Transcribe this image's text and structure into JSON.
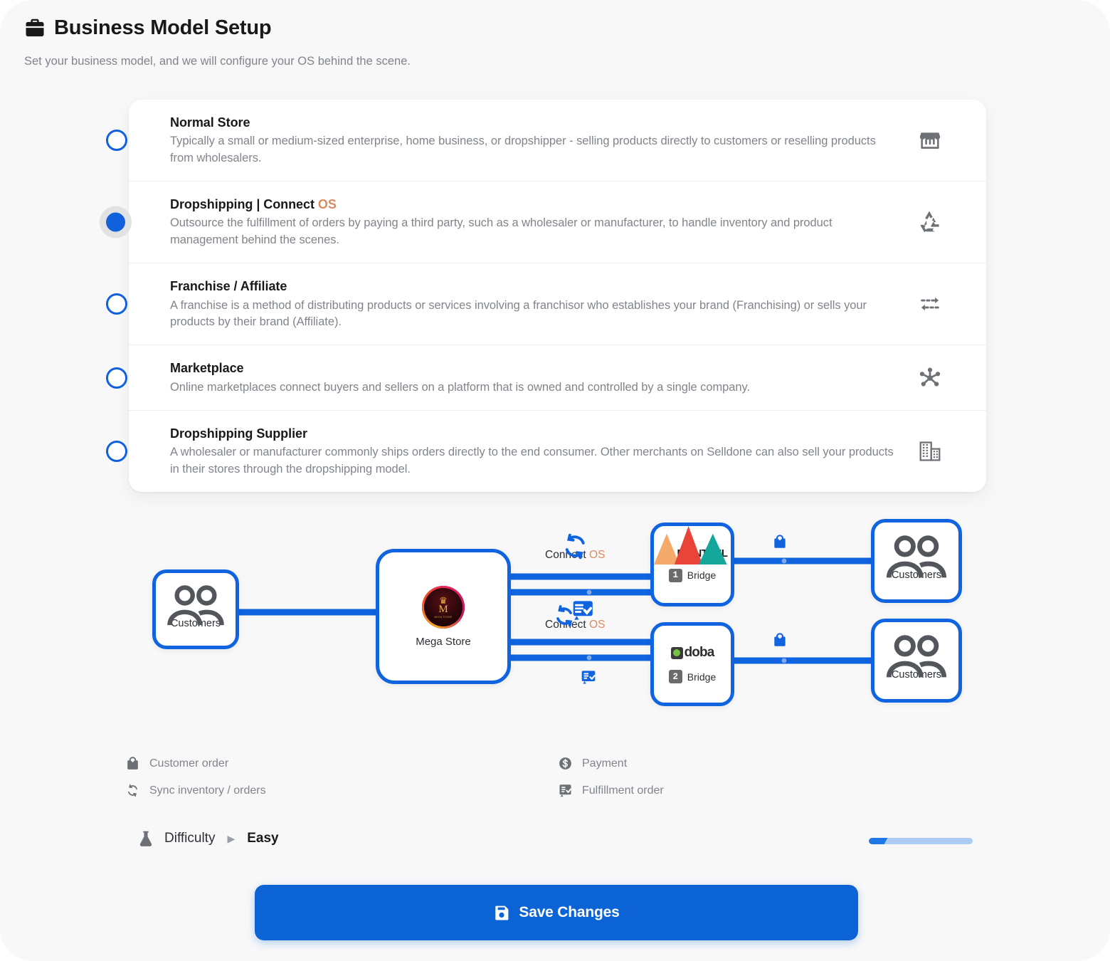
{
  "header": {
    "icon": "briefcase-icon",
    "title": "Business Model Setup",
    "subtitle": "Set your business model, and we will configure your OS behind the scene."
  },
  "options": [
    {
      "id": "normal-store",
      "title": "Normal Store",
      "title_accent": "",
      "description": "Typically a small or medium-sized enterprise, home business, or dropshipper - selling products directly to customers or reselling products from wholesalers.",
      "icon": "storefront-icon",
      "selected": false
    },
    {
      "id": "dropshipping-connect-os",
      "title": "Dropshipping | Connect ",
      "title_accent": "OS",
      "description": "Outsource the fulfillment of orders by paying a third party, such as a wholesaler or manufacturer, to handle inventory and product management behind the scenes.",
      "icon": "recycle-icon",
      "selected": true
    },
    {
      "id": "franchise-affiliate",
      "title": "Franchise / Affiliate",
      "title_accent": "",
      "description": "A franchise is a method of distributing products or services involving a franchisor who establishes your brand (Franchising) or sells your products by their brand (Affiliate).",
      "icon": "transfer-arrows-icon",
      "selected": false
    },
    {
      "id": "marketplace",
      "title": "Marketplace",
      "title_accent": "",
      "description": "Online marketplaces connect buyers and sellers on a platform that is owned and controlled by a single company.",
      "icon": "hub-network-icon",
      "selected": false
    },
    {
      "id": "dropshipping-supplier",
      "title": "Dropshipping Supplier",
      "title_accent": "",
      "description": "A wholesaler or manufacturer commonly ships orders directly to the end consumer. Other merchants on Selldone can also sell your products in their stores through the dropshipping model.",
      "icon": "warehouse-building-icon",
      "selected": false
    }
  ],
  "diagram": {
    "nodes": {
      "customers_left": {
        "label": "Customers",
        "icon": "people-icon"
      },
      "store": {
        "label": "Mega Store",
        "logo": "mega-store-logo"
      },
      "bridge1": {
        "brand": "PRINTFUL",
        "number": "1",
        "bridge_label": "Bridge"
      },
      "bridge2": {
        "brand": "doba",
        "number": "2",
        "bridge_label": "Bridge"
      },
      "customers_right_1": {
        "label": "Customers",
        "icon": "people-icon"
      },
      "customers_right_2": {
        "label": "Customers",
        "icon": "people-icon"
      }
    },
    "edge_labels": [
      {
        "text": "Connect ",
        "accent": "OS",
        "icon": "sync-icon"
      },
      {
        "text": "Connect ",
        "accent": "OS",
        "icon": "sync-fulfillment-icon"
      }
    ],
    "mini_icons": [
      {
        "name": "fulfillment-order-icon"
      },
      {
        "name": "customer-order-bag-icon"
      },
      {
        "name": "customer-order-bag-icon"
      }
    ]
  },
  "legend": [
    {
      "icon": "customer-order-bag-icon",
      "label": "Customer order"
    },
    {
      "icon": "payment-dollar-icon",
      "label": "Payment"
    },
    {
      "icon": "sync-icon",
      "label": "Sync inventory / orders"
    },
    {
      "icon": "fulfillment-order-icon",
      "label": "Fulfillment order"
    }
  ],
  "difficulty": {
    "icon": "flask-icon",
    "label": "Difficulty",
    "arrow": "▶",
    "value": "Easy",
    "percent": 20
  },
  "save": {
    "icon": "save-disk-icon",
    "label": "Save Changes"
  },
  "colors": {
    "accent_blue": "#1064e0",
    "button_blue": "#0b63d6",
    "accent_orange": "#d98b63",
    "text_dark": "#18191b",
    "text_muted": "#80858c",
    "page_bg": "#f8f8f9",
    "bar_track": "#aecbf3",
    "bar_fill": "#2077e6"
  }
}
